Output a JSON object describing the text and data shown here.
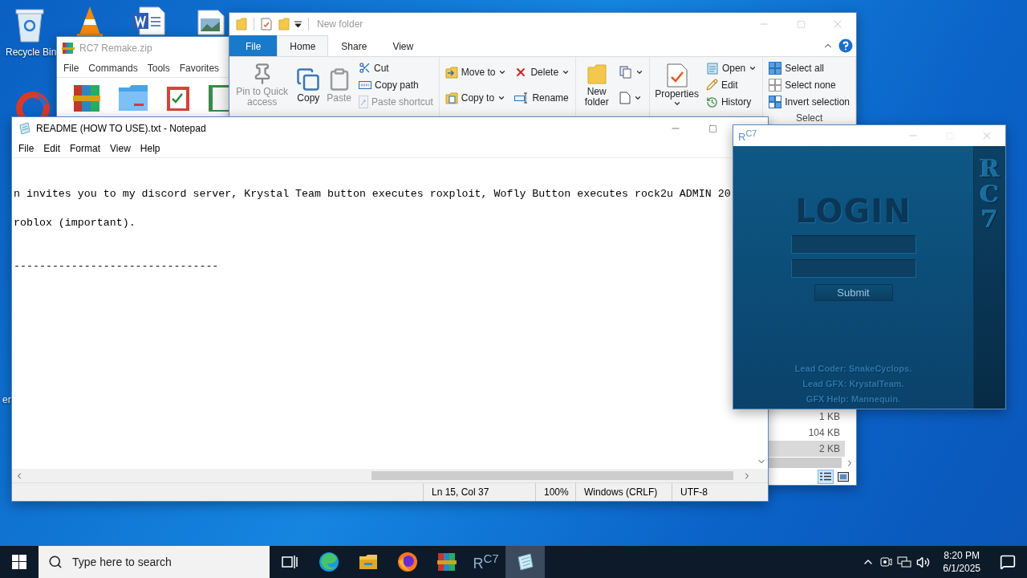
{
  "desktop": {
    "labels": [
      {
        "text": "Recycle Bin",
        "kind": "recycle"
      },
      {
        "text": "er",
        "kind": "edge"
      }
    ]
  },
  "winrar": {
    "title": "RC7 Remake.zip",
    "menu": [
      "File",
      "Commands",
      "Tools",
      "Favorites"
    ]
  },
  "explorer": {
    "title": "New folder",
    "tabs": [
      {
        "label": "File",
        "kind": "file",
        "selected": false
      },
      {
        "label": "Home",
        "kind": "tab",
        "selected": true
      },
      {
        "label": "Share",
        "kind": "tab",
        "selected": false
      },
      {
        "label": "View",
        "kind": "tab",
        "selected": false
      }
    ],
    "groups": [
      {
        "columns": [
          [
            {
              "label": "Pin to Quick access",
              "kind": "large",
              "disabled": true,
              "dropdown": false
            }
          ],
          [
            {
              "label": "Copy",
              "kind": "large",
              "disabled": false,
              "dropdown": false
            }
          ],
          [
            {
              "label": "Paste",
              "kind": "large",
              "disabled": true,
              "dropdown": false
            }
          ],
          [
            {
              "label": "Cut",
              "kind": "small",
              "disabled": false,
              "dropdown": false
            },
            {
              "label": "Copy path",
              "kind": "small",
              "disabled": false,
              "dropdown": false
            },
            {
              "label": "Paste shortcut",
              "kind": "small",
              "disabled": true,
              "dropdown": false
            }
          ]
        ]
      },
      {
        "columns": [
          [
            {
              "label": "Move to",
              "kind": "small",
              "disabled": false,
              "dropdown": true
            },
            {
              "label": "Copy to",
              "kind": "small",
              "disabled": false,
              "dropdown": true
            }
          ],
          [
            {
              "label": "Delete",
              "kind": "small",
              "disabled": false,
              "dropdown": true
            },
            {
              "label": "Rename",
              "kind": "small",
              "disabled": false,
              "dropdown": false
            }
          ]
        ]
      },
      {
        "columns": [
          [
            {
              "label": "New folder",
              "kind": "large",
              "disabled": false,
              "dropdown": false
            }
          ],
          [
            {
              "kind": "small",
              "disabled": false,
              "dropdown": true
            },
            {
              "kind": "small",
              "disabled": false,
              "dropdown": true
            }
          ]
        ]
      },
      {
        "columns": [
          [
            {
              "label": "Properties",
              "kind": "large",
              "disabled": false,
              "dropdown": true
            }
          ],
          [
            {
              "label": "Open",
              "kind": "small",
              "disabled": false,
              "dropdown": true
            },
            {
              "label": "Edit",
              "kind": "small",
              "disabled": false,
              "dropdown": false
            },
            {
              "label": "History",
              "kind": "small",
              "disabled": false,
              "dropdown": false
            }
          ]
        ]
      },
      {
        "label": "Select",
        "columns": [
          [
            {
              "label": "Select all",
              "kind": "small",
              "disabled": false,
              "dropdown": false
            },
            {
              "label": "Select none",
              "kind": "small",
              "disabled": false,
              "dropdown": false
            },
            {
              "label": "Invert selection",
              "kind": "small",
              "disabled": false,
              "dropdown": false
            }
          ]
        ]
      }
    ],
    "rows": [
      {
        "size": "1 KB",
        "selected": false
      },
      {
        "size": "104 KB",
        "selected": false
      },
      {
        "size": "2 KB",
        "selected": true
      }
    ],
    "view_buttons": [
      {
        "kind": "details",
        "selected": true
      },
      {
        "kind": "tiles",
        "selected": false
      }
    ]
  },
  "notepad": {
    "title": "README (HOW TO USE).txt - Notepad",
    "menu": [
      "File",
      "Edit",
      "Format",
      "View",
      "Help"
    ],
    "lines": [
      {
        "text": "n invites you to my discord server, Krystal Team button executes roxploit, Wofly Button executes rock2u ADMIN 20",
        "kind": "paragraph"
      },
      {
        "text": "roblox (important).",
        "kind": "paragraph"
      },
      {
        "text": "--------------------------------",
        "kind": "rule"
      }
    ],
    "status": [
      "Ln 15, Col 37",
      "100%",
      "Windows (CRLF)",
      "UTF-8"
    ]
  },
  "rc7": {
    "title_logo": "R$^{C7}$",
    "heading": "LOGIN",
    "button": "Submit",
    "credits": [
      "Lead Coder: SnakeCyclops.",
      "Lead GFX: KrystalTeam.",
      "GFX Help: Mannequin."
    ],
    "logo": "RC7"
  },
  "taskbar": {
    "search": {
      "placeholder": "Type here to search"
    },
    "apps": [
      {
        "kind": "taskview",
        "selected": false
      },
      {
        "kind": "edge",
        "selected": false
      },
      {
        "kind": "explorer",
        "selected": false
      },
      {
        "kind": "firefox",
        "selected": false
      },
      {
        "kind": "winrar",
        "selected": false
      },
      {
        "kind": "rc7",
        "label": "R$^{C7}$",
        "selected": false
      },
      {
        "kind": "notepad",
        "selected": true
      }
    ],
    "time": "8:20 PM",
    "date": "6/1/2025"
  }
}
